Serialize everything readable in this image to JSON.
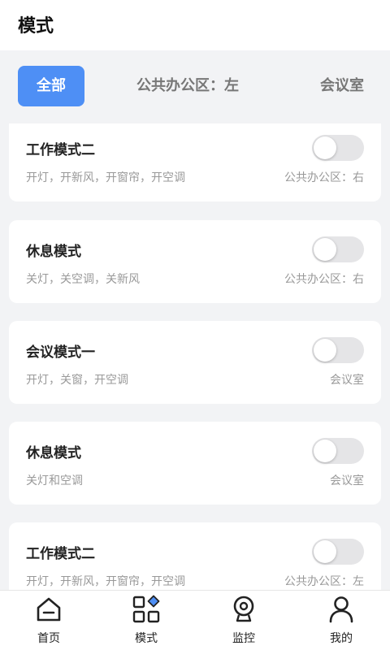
{
  "header": {
    "title": "模式"
  },
  "tabs": [
    {
      "label": "全部",
      "active": true
    },
    {
      "label": "公共办公区：左",
      "active": false
    },
    {
      "label": "会议室",
      "active": false
    }
  ],
  "modes": [
    {
      "title": "工作模式二",
      "desc": "开灯，开新风，开窗帘，开空调",
      "room": "公共办公区：右",
      "enabled": false
    },
    {
      "title": "休息模式",
      "desc": "关灯，关空调，关新风",
      "room": "公共办公区：右",
      "enabled": false
    },
    {
      "title": "会议模式一",
      "desc": "开灯，关窗，开空调",
      "room": "会议室",
      "enabled": false
    },
    {
      "title": "休息模式",
      "desc": "关灯和空调",
      "room": "会议室",
      "enabled": false
    },
    {
      "title": "工作模式二",
      "desc": "开灯，开新风，开窗帘，开空调",
      "room": "公共办公区：左",
      "enabled": false
    }
  ],
  "tabbar": [
    {
      "label": "首页",
      "icon": "home-icon"
    },
    {
      "label": "模式",
      "icon": "mode-grid-icon"
    },
    {
      "label": "监控",
      "icon": "camera-icon"
    },
    {
      "label": "我的",
      "icon": "user-icon"
    }
  ],
  "colors": {
    "accent": "#4e8ff5",
    "toggle_off": "#e5e5e7",
    "background": "#f2f3f5"
  }
}
